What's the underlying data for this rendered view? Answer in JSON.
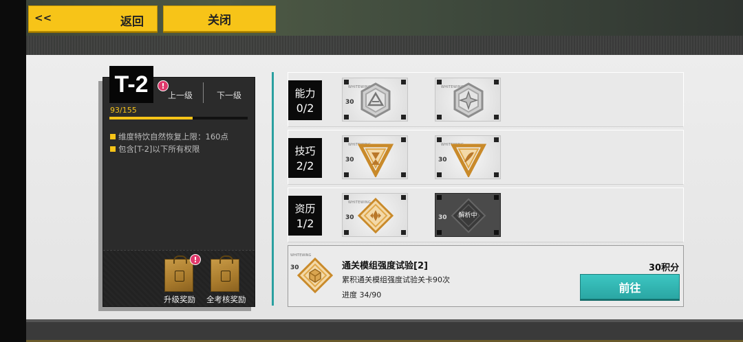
{
  "header": {
    "back_chevron": "<<",
    "back_label": "返回",
    "close_label": "关闭"
  },
  "rank": {
    "title": "T-2",
    "alert": "!",
    "prev_label": "上一级",
    "next_label": "下一级",
    "progress_text": "93/155",
    "progress_fraction": 0.6,
    "perks": [
      "维度特饮自然恢复上限：160点",
      "包含[T-2]以下所有权限"
    ],
    "rewards": [
      {
        "label": "升级奖励",
        "alert": "!"
      },
      {
        "label": "全考核奖励"
      }
    ]
  },
  "categories": [
    {
      "name": "能力",
      "count": "0/2",
      "badges": [
        {
          "watermark": "WHITEWING",
          "points": "30",
          "style": "silver-hex-triangle",
          "icon": "silver-hex-triangle-icon"
        },
        {
          "watermark": "WHITEWING",
          "points": "",
          "style": "silver-hex-star",
          "icon": "silver-hex-star-icon"
        }
      ]
    },
    {
      "name": "技巧",
      "count": "2/2",
      "badges": [
        {
          "watermark": "WHITEWING",
          "points": "30",
          "style": "gold-triangle-hourglass",
          "icon": "gold-triangle-hourglass-icon"
        },
        {
          "watermark": "WHITEWING",
          "points": "30",
          "style": "gold-triangle-feather",
          "icon": "gold-triangle-feather-icon"
        }
      ]
    },
    {
      "name": "资历",
      "count": "1/2",
      "badges": [
        {
          "watermark": "WHITEWING",
          "points": "30",
          "style": "gold-diamond",
          "icon": "gold-diamond-icon"
        },
        {
          "watermark": "",
          "points": "30",
          "style": "locked",
          "icon": "locked-diamond-icon",
          "status": "解析中"
        }
      ]
    }
  ],
  "task": {
    "watermark": "WHITEWING",
    "points": "30",
    "title": "通关模组强度试验[2]",
    "description": "累积通关模组强度试验关卡90次",
    "progress": "进度 34/90",
    "reward": "30积分",
    "button_label": "前往",
    "icon": "gold-diamond-cube-icon"
  },
  "colors": {
    "accent_yellow": "#f7c418",
    "accent_teal": "#2aa6a3",
    "alert_pink": "#e0396c"
  }
}
